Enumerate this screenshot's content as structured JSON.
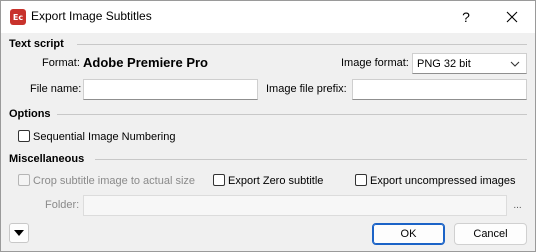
{
  "window": {
    "title": "Export Image Subtitles",
    "app_icon_text": "Ec",
    "help_label": "?"
  },
  "text_script": {
    "section_label": "Text script",
    "format_label": "Format:",
    "format_value": "Adobe Premiere Pro",
    "image_format_label": "Image format:",
    "image_format_value": "PNG 32 bit",
    "file_name_label": "File name:",
    "file_name_value": "",
    "image_prefix_label": "Image file prefix:",
    "image_prefix_value": ""
  },
  "options": {
    "section_label": "Options",
    "sequential_label": "Sequential Image Numbering",
    "sequential_checked": false
  },
  "misc": {
    "section_label": "Miscellaneous",
    "crop_label": "Crop subtitle image to actual size",
    "crop_checked": false,
    "crop_disabled": true,
    "export_zero_label": "Export Zero subtitle",
    "export_zero_checked": false,
    "export_uncompressed_label": "Export uncompressed images",
    "export_uncompressed_checked": false,
    "folder_label": "Folder:",
    "folder_value": "",
    "browse_label": "..."
  },
  "footer": {
    "ok_label": "OK",
    "cancel_label": "Cancel"
  },
  "colors": {
    "app_icon_bg": "#c8322c",
    "default_button_border": "#1b63c7"
  }
}
